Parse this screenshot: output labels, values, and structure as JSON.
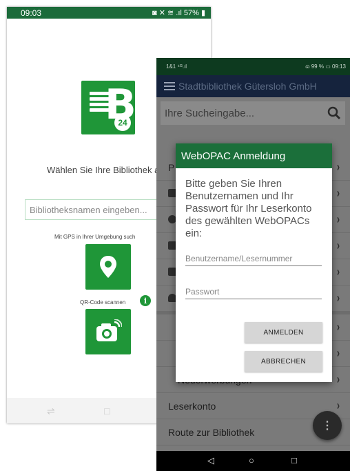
{
  "phone1": {
    "status": {
      "time": "09:03",
      "indicators": "◙ ✕ ≋ .ıl 57% ▮"
    },
    "logo": {
      "letter": "B",
      "badge": "24"
    },
    "choose_text": "Wählen Sie Ihre Bibliothek a",
    "search": {
      "placeholder": "Bibliotheksnamen eingeben..."
    },
    "gps_text": "Mit GPS in Ihrer Umgebung such",
    "qr_text": "QR-Code scannen",
    "info_glyph": "i"
  },
  "phone2": {
    "status": {
      "left": "1&1 ⁴ᴳ.ıl",
      "right": "ɷ 99 % ▭ 09:13"
    },
    "app_title": "Stadtbibliothek Gütersloh GmbH",
    "search": {
      "placeholder": "Ihre Sucheingabe...",
      "icon": "search-icon"
    },
    "rows": [
      {
        "label": "P",
        "icon": ""
      },
      {
        "label": "",
        "icon": "mail-icon"
      },
      {
        "label": "",
        "icon": "clock-icon"
      },
      {
        "label": "",
        "icon": "calendar-icon"
      },
      {
        "label": "",
        "icon": "book-icon"
      },
      {
        "label": "",
        "icon": "person-icon"
      }
    ],
    "lower_rows": [
      {
        "label": ""
      },
      {
        "label": ""
      },
      {
        "label": "Neuerwerbungen"
      },
      {
        "label": "Leserkonto"
      },
      {
        "label": "Route zur Bibliothek"
      }
    ],
    "fab_glyph": "⋮",
    "dialog": {
      "title": "WebOPAC Anmeldung",
      "message": "Bitte geben Sie Ihren Benutzernamen und Ihr Passwort für Ihr Leserkonto des gewählten WebOPACs ein:",
      "username_placeholder": "Benutzername/Lesernummer",
      "password_placeholder": "Passwort",
      "login_label": "ANMELDEN",
      "cancel_label": "ABBRECHEN"
    },
    "nav": {
      "back": "◁",
      "home": "○",
      "recent": "□"
    }
  },
  "colors": {
    "brand_green": "#1f9638",
    "dialog_header": "#1b6f3a",
    "status_bar_back": "#1b6b3a",
    "overlay_gray": "#7a7a7a"
  }
}
